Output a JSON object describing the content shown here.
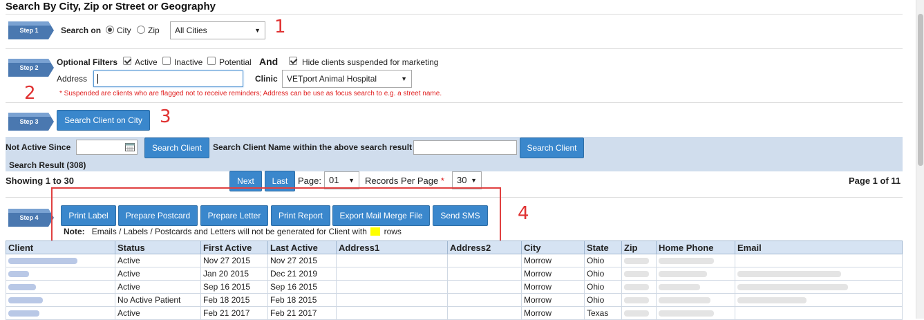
{
  "page": {
    "title": "Search By City, Zip or Street or Geography"
  },
  "annotations": [
    "1",
    "2",
    "3",
    "4"
  ],
  "steps": [
    "Step 1",
    "Step 2",
    "Step 3",
    "Step 4"
  ],
  "step1": {
    "label": "Search on",
    "radio_city": "City",
    "radio_zip": "Zip",
    "selected": "city",
    "city_select": "All Cities"
  },
  "step2": {
    "label": "Optional Filters",
    "active": "Active",
    "inactive": "Inactive",
    "potential": "Potential",
    "and": "And",
    "hide_suspended": "Hide clients suspended for marketing",
    "address_label": "Address",
    "address_value": "",
    "clinic_label": "Clinic",
    "clinic_select": "VETport Animal Hospital",
    "note": "* Suspended are clients who are flagged not to receive reminders; Address can be use as focus search to e.g. a street name."
  },
  "step3": {
    "search_button": "Search Client on City"
  },
  "filterbar": {
    "not_active_since": "Not Active Since",
    "search_button": "Search Client",
    "name_search_label": "Search Client Name within the above search result",
    "name_search_button": "Search Client",
    "result_count": "Search Result (308)"
  },
  "pagination": {
    "showing": "Showing 1 to 30",
    "next": "Next",
    "last": "Last",
    "page_label": "Page:",
    "page_value": "01",
    "records_label": "Records Per Page",
    "required_mark": "*",
    "records_value": "30",
    "page_of": "Page 1 of 11"
  },
  "step4": {
    "print_label": "Print Label",
    "prepare_postcard": "Prepare Postcard",
    "prepare_letter": "Prepare Letter",
    "print_report": "Print Report",
    "export_mail_merge": "Export Mail Merge File",
    "send_sms": "Send SMS",
    "note_label": "Note:",
    "note_text": "Emails / Labels / Postcards and Letters will not be generated for Client with",
    "note_tail": "rows"
  },
  "table": {
    "columns": [
      "Client",
      "Status",
      "First Active",
      "Last Active",
      "Address1",
      "Address2",
      "City",
      "State",
      "Zip",
      "Home Phone",
      "Email"
    ],
    "rows": [
      {
        "status": "Active",
        "first": "Nov 27 2015",
        "last": "Nov 27 2015",
        "city": "Morrow",
        "state": "Ohio"
      },
      {
        "status": "Active",
        "first": "Jan 20 2015",
        "last": "Dec 21 2019",
        "city": "Morrow",
        "state": "Ohio"
      },
      {
        "status": "Active",
        "first": "Sep 16 2015",
        "last": "Sep 16 2015",
        "city": "Morrow",
        "state": "Ohio"
      },
      {
        "status": "No Active Patient",
        "first": "Feb 18 2015",
        "last": "Feb 18 2015",
        "city": "Morrow",
        "state": "Ohio"
      },
      {
        "status": "Active",
        "first": "Feb 21 2017",
        "last": "Feb 21 2017",
        "city": "Morrow",
        "state": "Texas"
      }
    ]
  },
  "colors": {
    "button": "#3a87cc",
    "band": "#d0dded",
    "step_badge": "#4a78b0",
    "annotation": "#e03232"
  }
}
